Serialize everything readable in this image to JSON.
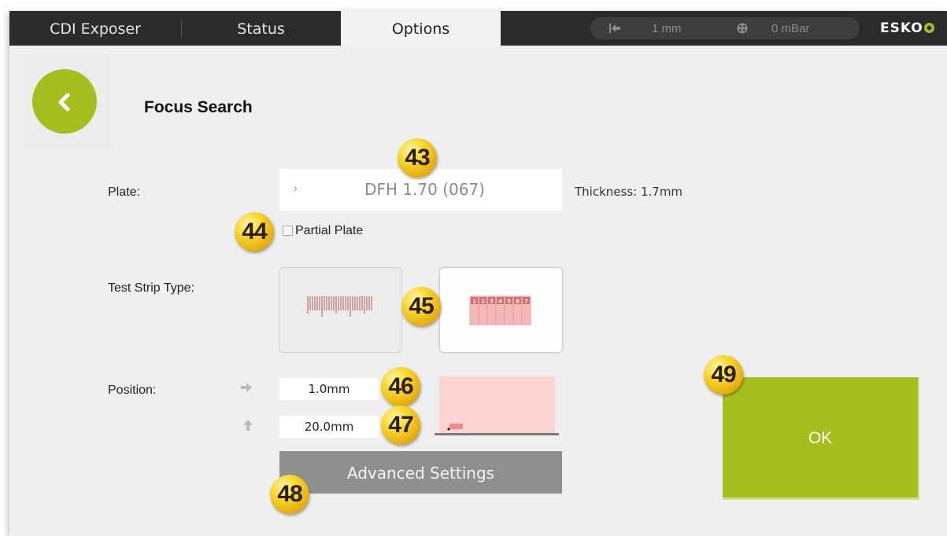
{
  "tabs": [
    {
      "label": "CDI Exposer"
    },
    {
      "label": "Status"
    },
    {
      "label": "Options"
    }
  ],
  "status": {
    "position_value": "1 mm",
    "vacuum_value": "0 mBar"
  },
  "brand": {
    "text": "ESKO"
  },
  "page": {
    "title": "Focus Search"
  },
  "plate": {
    "label": "Plate:",
    "value": "DFH 1.70 (067)",
    "thickness": "Thickness: 1.7mm",
    "partial_label": "Partial Plate",
    "partial_checked": false
  },
  "test_strip": {
    "label": "Test Strip Type:",
    "selected": "numbered",
    "numbers": [
      "1",
      "2",
      "3",
      "4",
      "5",
      "6",
      "7"
    ]
  },
  "position": {
    "label": "Position:",
    "x_value": "1.0mm",
    "y_value": "20.0mm"
  },
  "advanced": {
    "label": "Advanced Settings"
  },
  "ok": {
    "label": "OK"
  },
  "callouts": [
    "43",
    "44",
    "45",
    "46",
    "47",
    "48",
    "49"
  ],
  "colors": {
    "accent": "#a6be1d",
    "badge": "#f5c518",
    "preview_fill": "#fdd4d4",
    "strip_red": "#c98080"
  }
}
